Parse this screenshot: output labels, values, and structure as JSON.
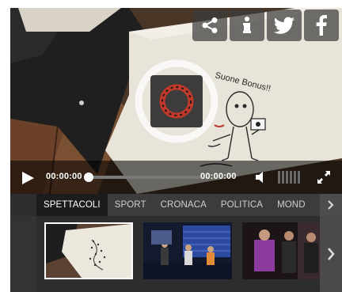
{
  "player": {
    "share_buttons": [
      {
        "icon": "share-icon"
      },
      {
        "icon": "info-icon"
      },
      {
        "icon": "twitter-icon"
      },
      {
        "icon": "facebook-icon"
      }
    ],
    "sketch_caption": "Suone Bonus!!",
    "current_time": "00:00:00",
    "duration": "00:00:00",
    "progress_fraction": 0.0,
    "volume_level_fraction": 0.0
  },
  "categories": {
    "items": [
      "SPETTACOLI",
      "SPORT",
      "CRONACA",
      "POLITICA",
      "MOND"
    ],
    "active_index": 0
  },
  "thumbnails": [
    {
      "name": "thumb-sketch",
      "selected": true
    },
    {
      "name": "thumb-tv-studio",
      "selected": false
    },
    {
      "name": "thumb-interview",
      "selected": false
    }
  ],
  "colors": {
    "control_bar": "#000000",
    "category_bar": "#3c3c3c",
    "active_tab": "#1c1c1c",
    "thumb_strip": "#2d2d2d",
    "text": "#ffffff"
  }
}
